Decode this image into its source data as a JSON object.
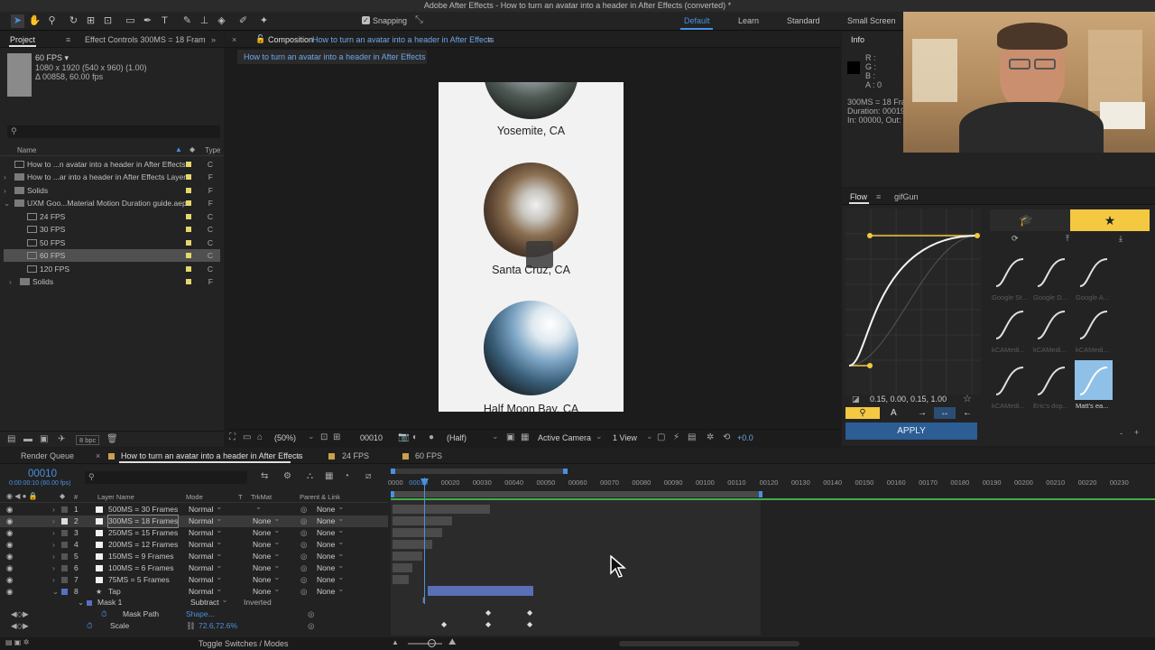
{
  "window": {
    "title": "Adobe After Effects - How to turn an avatar into a header in After Effects (converted) *"
  },
  "toolbar": {
    "snapping_label": "Snapping",
    "workspaces": [
      "Default",
      "Learn",
      "Standard",
      "Small Screen"
    ],
    "active_workspace": "Default"
  },
  "project_panel": {
    "tab_project": "Project",
    "tab_effects": "Effect Controls 300MS = 18 Fram",
    "info_fps": "60 FPS ▾",
    "info_size": "1080 x 1920  (540 x 960) (1.00)",
    "info_duration": "Δ 00858, 60.00 fps",
    "search_placeholder": "",
    "col_name": "Name",
    "col_type": "Type",
    "items": [
      {
        "label": "How to ...n avatar into a header in After Effects",
        "type": "C",
        "kind": "comp"
      },
      {
        "label": "How to ...ar into a header in After Effects Layers",
        "type": "F",
        "kind": "folder"
      },
      {
        "label": "Solids",
        "type": "F",
        "kind": "folder"
      },
      {
        "label": "UXM Goo...Material Motion Duration guide.aep",
        "type": "F",
        "kind": "folder"
      },
      {
        "label": "24 FPS",
        "type": "C",
        "kind": "comp"
      },
      {
        "label": "30 FPS",
        "type": "C",
        "kind": "comp"
      },
      {
        "label": "50 FPS",
        "type": "C",
        "kind": "comp"
      },
      {
        "label": "60 FPS",
        "type": "C",
        "kind": "comp",
        "selected": true
      },
      {
        "label": "120 FPS",
        "type": "C",
        "kind": "comp"
      },
      {
        "label": "Solids",
        "type": "F",
        "kind": "folder"
      }
    ],
    "bpc": "8 bpc"
  },
  "composition": {
    "tab_prefix": "Composition",
    "tab_name": "How to turn an avatar into a header in After Effects",
    "breadcrumb": "How to turn an avatar into a header in After Effects",
    "places": [
      "Yosemite, CA",
      "Santa Cruz, CA",
      "Half Moon Bay, CA"
    ],
    "zoom": "(50%)",
    "timecode": "00010",
    "resolution": "(Half)",
    "camera": "Active Camera",
    "views": "1 View",
    "exposure": "+0.0"
  },
  "info_panel": {
    "tab": "Info",
    "r": "R :",
    "g": "G :",
    "b": "B :",
    "a": "A :  0",
    "comp_name": "300MS = 18 Fram",
    "duration": "Duration: 00019",
    "in_out": "In: 00000, Out: 0"
  },
  "flow_panel": {
    "tab_flow": "Flow",
    "tab_gifgun": "gifGun",
    "values": "0.15, 0.00, 0.15, 1.00",
    "apply_label": "APPLY",
    "presets": [
      "Google St...",
      "Google D...",
      "Google A...",
      "kCAMedi...",
      "kCAMedi...",
      "kCAMedi...",
      "kCAMedi...",
      "Eric's dop...",
      "Matt's ea..."
    ]
  },
  "timeline": {
    "tab_render": "Render Queue",
    "tab_comp": "How to turn an avatar into a header in After Effects",
    "tab_24": "24 FPS",
    "tab_60": "60 FPS",
    "timecode": "00010",
    "timecode_sub": "0:00:00:10 (60.00 fps)",
    "cols": {
      "num": "#",
      "name": "Layer Name",
      "mode": "Mode",
      "t": "T",
      "trkmat": "TrkMat",
      "parent": "Parent & Link"
    },
    "ticks": [
      "0000",
      "00010",
      "00020",
      "00030",
      "00040",
      "00050",
      "00060",
      "00070",
      "00080",
      "00090",
      "00100",
      "00110",
      "00120",
      "00130",
      "00140",
      "00150",
      "00160",
      "00170",
      "00180",
      "00190",
      "00200",
      "00210",
      "00220",
      "00230"
    ],
    "layers": [
      {
        "num": "1",
        "name": "500MS = 30 Frames",
        "mode": "Normal",
        "trk": "",
        "parent": "None",
        "bar_end": 108
      },
      {
        "num": "2",
        "name": "300MS = 18 Frames",
        "mode": "Normal",
        "trk": "None",
        "parent": "None",
        "bar_end": 66,
        "selected": true
      },
      {
        "num": "3",
        "name": "250MS = 15 Frames",
        "mode": "Normal",
        "trk": "None",
        "parent": "None",
        "bar_end": 55
      },
      {
        "num": "4",
        "name": "200MS = 12 Frames",
        "mode": "Normal",
        "trk": "None",
        "parent": "None",
        "bar_end": 44
      },
      {
        "num": "5",
        "name": "150MS = 9 Frames",
        "mode": "Normal",
        "trk": "None",
        "parent": "None",
        "bar_end": 33
      },
      {
        "num": "6",
        "name": "100MS = 6 Frames",
        "mode": "Normal",
        "trk": "None",
        "parent": "None",
        "bar_end": 22
      },
      {
        "num": "7",
        "name": "75MS = 5 Frames",
        "mode": "Normal",
        "trk": "None",
        "parent": "None",
        "bar_end": 18
      },
      {
        "num": "8",
        "name": "Tap",
        "mode": "Normal",
        "trk": "None",
        "parent": "None",
        "bar_end": 0
      }
    ],
    "mask_label": "Mask 1",
    "mask_mode": "Subtract",
    "mask_inverted": "Inverted",
    "mask_path_label": "Mask Path",
    "mask_path_value": "Shape...",
    "scale_label": "Scale",
    "scale_value": "72.6,72.6%",
    "toggle_label": "Toggle Switches / Modes"
  },
  "colors": {
    "accent": "#4a90e2",
    "flow_yellow": "#f5c842",
    "label_yellow": "#e3d86c"
  }
}
